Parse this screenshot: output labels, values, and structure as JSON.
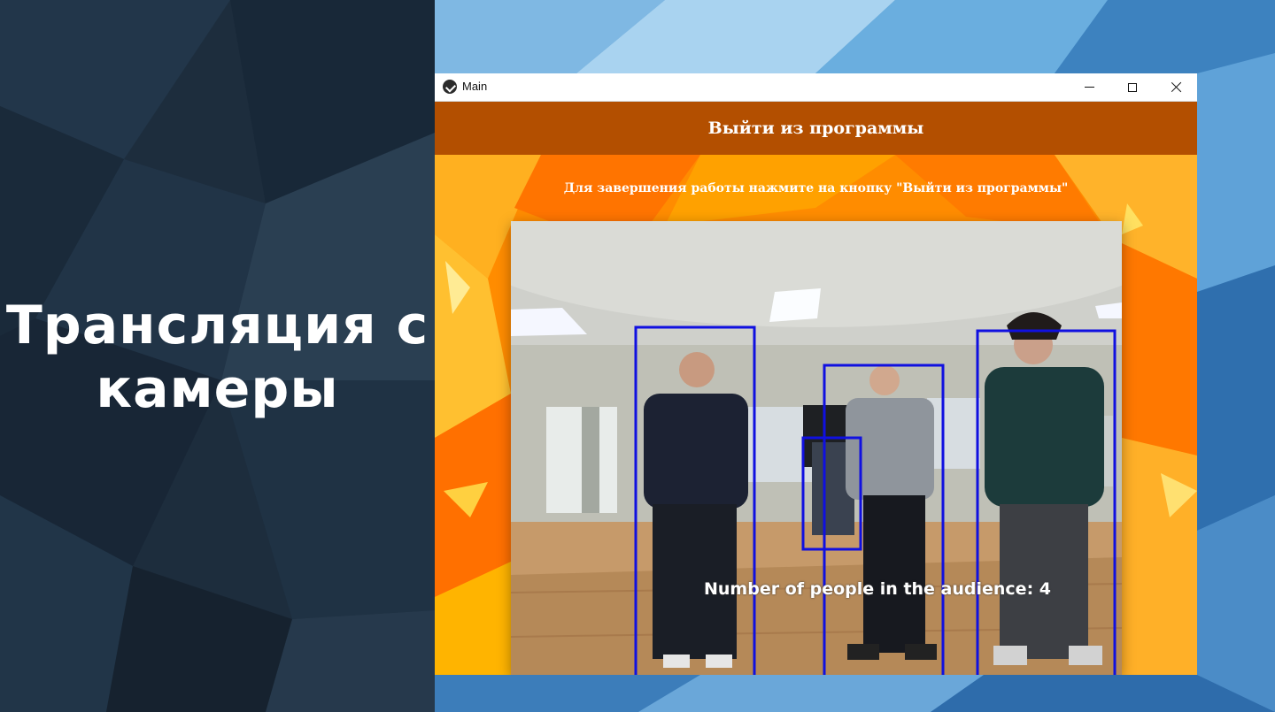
{
  "slide": {
    "title": "Трансляция с камеры"
  },
  "window": {
    "title": "Main",
    "controls": [
      "minimize",
      "maximize",
      "close"
    ]
  },
  "app": {
    "exit_button_label": "Выйти из программы",
    "hint_text": "Для завершения работы нажмите на кнопку \"Выйти из программы\"",
    "camera": {
      "overlay_text": "Number of people in the audience: 4",
      "detection_count": 4,
      "box_color": "#1010e0"
    }
  },
  "colors": {
    "left_panel": "#1d2d3d",
    "desktop": "#4a90c8",
    "app_background": "#ff8a00",
    "exit_bar": "#963700"
  }
}
